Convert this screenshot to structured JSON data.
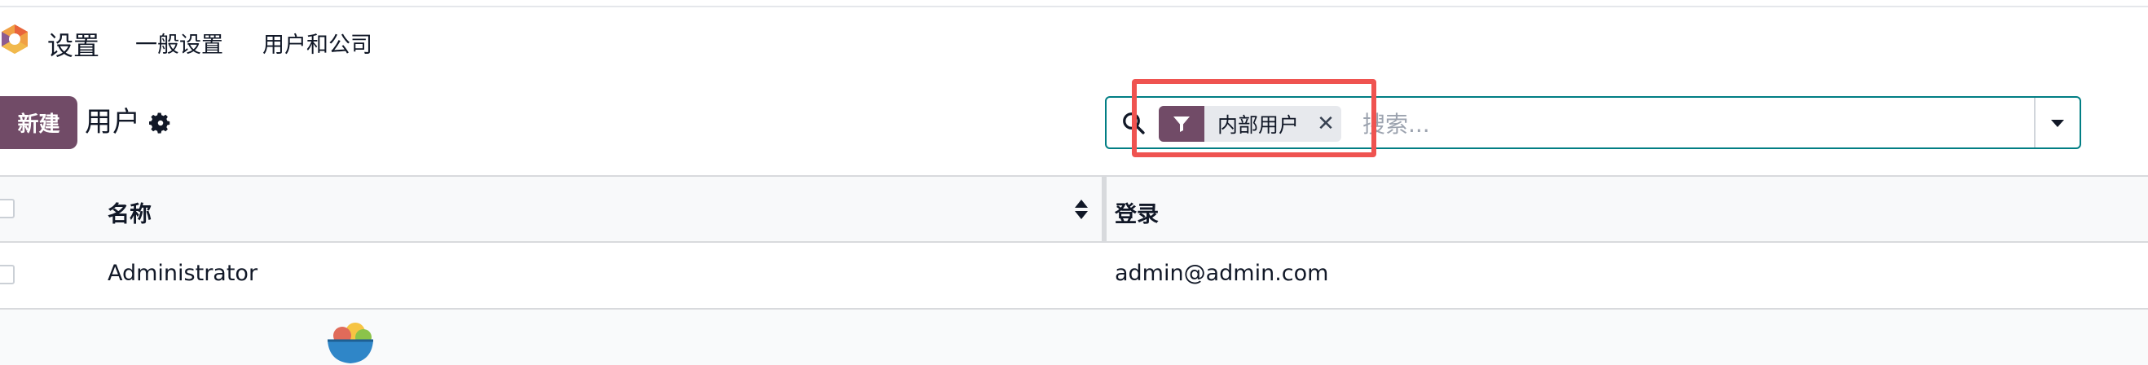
{
  "nav": {
    "app_name": "设置",
    "menu_items": [
      "一般设置",
      "用户和公司"
    ]
  },
  "control_panel": {
    "new_button": "新建",
    "title": "用户"
  },
  "search": {
    "facet_label": "内部用户",
    "placeholder": "搜索..."
  },
  "table": {
    "columns": [
      "名称",
      "登录"
    ],
    "rows": [
      {
        "name": "Administrator",
        "login": "admin@admin.com"
      }
    ]
  },
  "colors": {
    "brand": "#714b67",
    "search_border": "#017e84",
    "highlight": "#ef5350"
  },
  "icons": [
    "app-logo-icon",
    "gear-icon",
    "search-icon",
    "filter-icon",
    "close-icon",
    "caret-down-icon",
    "sort-icon",
    "empty-bowl-icon"
  ]
}
